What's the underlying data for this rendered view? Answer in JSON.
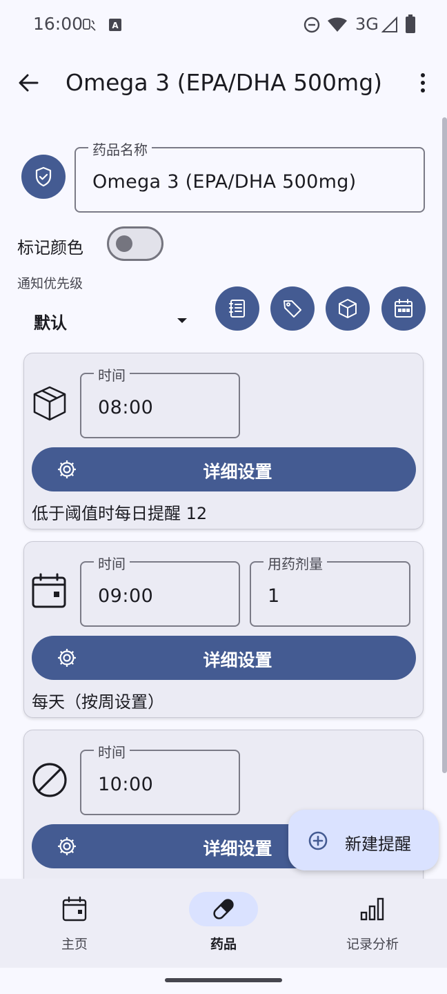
{
  "status_bar": {
    "time": "16:00",
    "network": "3G",
    "icons": [
      "notification-app-icon",
      "keyboard-a-icon",
      "do-not-disturb-icon",
      "wifi-icon",
      "signal-icon",
      "battery-icon"
    ]
  },
  "app_bar": {
    "title": "Omega 3 (EPA/DHA 500mg)",
    "icons": [
      "back-arrow-icon",
      "more-vert-icon"
    ]
  },
  "medicine": {
    "name_label": "药品名称",
    "name_value": "Omega 3 (EPA/DHA 500mg)",
    "icon": "shield-check-icon"
  },
  "color_mark": {
    "label": "标记颜色",
    "enabled": false
  },
  "priority": {
    "label": "通知优先级",
    "value": "默认"
  },
  "action_buttons": [
    "notes-icon",
    "tag-icon",
    "box-icon",
    "calendar-icon"
  ],
  "reminders": [
    {
      "icon": "box-icon",
      "time_label": "时间",
      "time_value": "08:00",
      "button_label": "详细设置",
      "description": "低于阈值时每日提醒 12"
    },
    {
      "icon": "calendar-icon",
      "time_label": "时间",
      "time_value": "09:00",
      "dose_label": "用药剂量",
      "dose_value": "1",
      "button_label": "详细设置",
      "description": "每天（按周设置）"
    },
    {
      "icon": "no-entry-icon",
      "time_label": "时间",
      "time_value": "10:00",
      "button_label": "详细设置",
      "description": ""
    }
  ],
  "fab": {
    "label": "新建提醒",
    "icon": "add-circle-icon"
  },
  "bottom_nav": {
    "active_index": 1,
    "items": [
      {
        "label": "主页",
        "icon": "calendar-icon"
      },
      {
        "label": "药品",
        "icon": "pill-icon"
      },
      {
        "label": "记录分析",
        "icon": "bar-chart-icon"
      }
    ]
  },
  "colors": {
    "primary": "#445b92",
    "background": "#f8f8ff",
    "card": "#ebebf4",
    "fab": "#dae2ff",
    "nav": "#ededf6"
  }
}
